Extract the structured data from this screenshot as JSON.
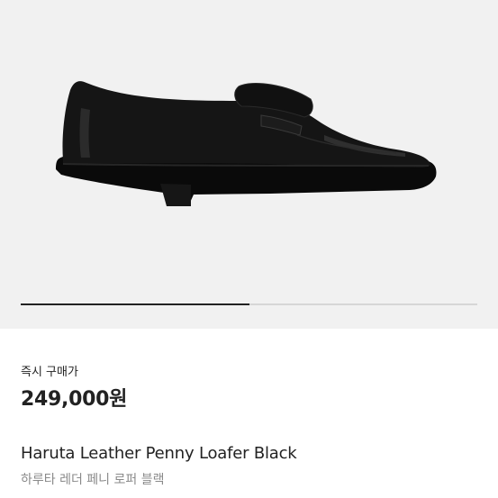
{
  "product": {
    "image_alt": "loafer-shoe",
    "carousel_progress": 0.5
  },
  "purchase": {
    "label": "즉시 구매가",
    "price": "249,000원"
  },
  "name": {
    "english": "Haruta Leather Penny Loafer Black",
    "korean": "하루타 레더 페니 로퍼 블랙"
  }
}
